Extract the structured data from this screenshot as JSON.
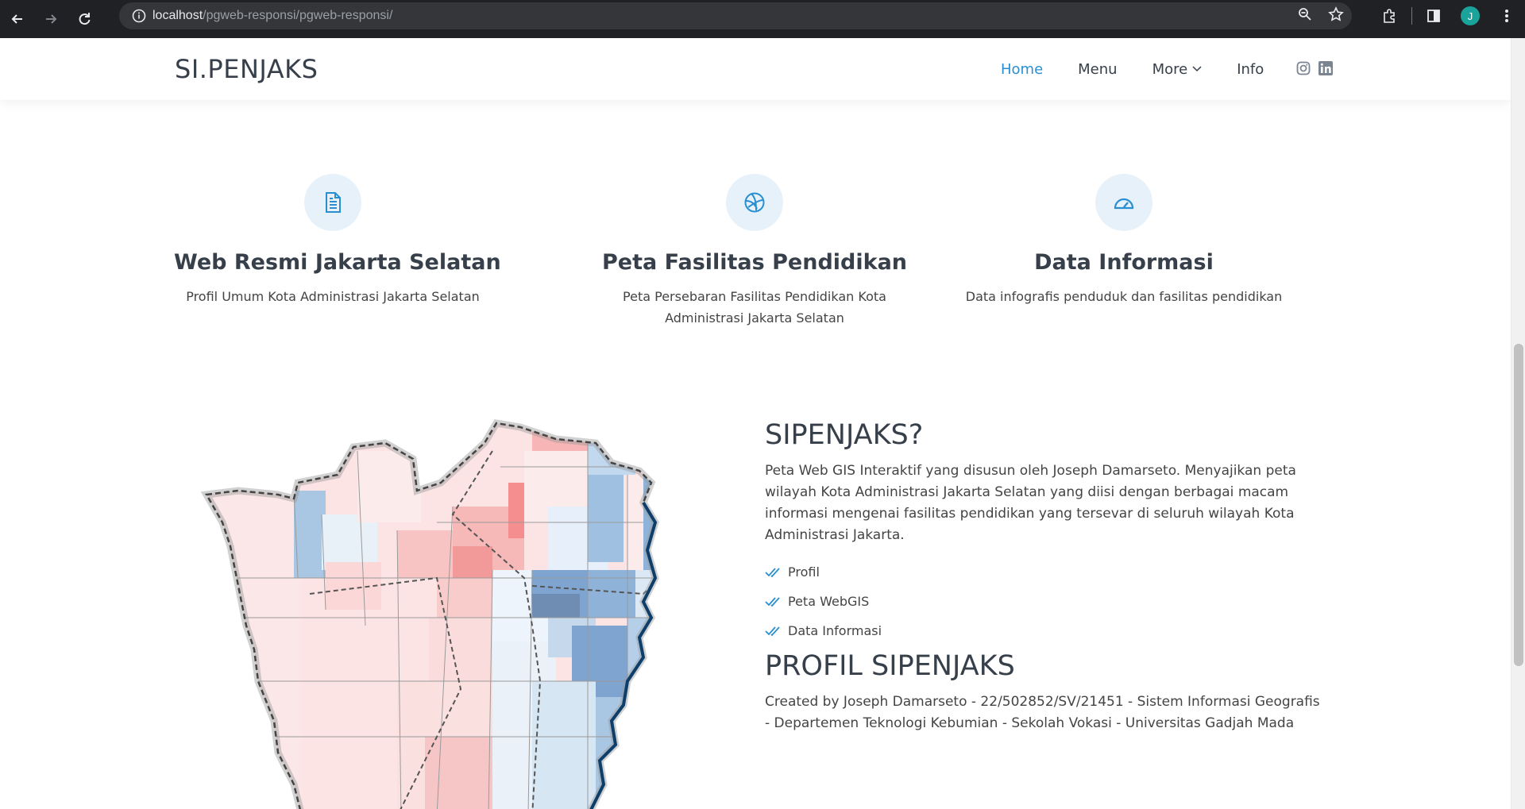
{
  "browser": {
    "url_host": "localhost",
    "url_path": "/pgweb-responsi/pgweb-responsi/",
    "avatar_letter": "J"
  },
  "header": {
    "logo": "SI.PENJAKS",
    "nav": [
      "Home",
      "Menu",
      "More",
      "Info"
    ],
    "active_color": "#2a8fd1"
  },
  "features": [
    {
      "icon": "document-icon",
      "title": "Web Resmi Jakarta Selatan",
      "desc": "Profil Umum Kota Administrasi Jakarta Selatan"
    },
    {
      "icon": "basketball-icon",
      "title": "Peta Fasilitas Pendidikan",
      "desc": "Peta Persebaran Fasilitas Pendidikan Kota Administrasi Jakarta Selatan"
    },
    {
      "icon": "speedometer-icon",
      "title": "Data Informasi",
      "desc": "Data infografis penduduk dan fasilitas pendidikan"
    }
  ],
  "about": {
    "title": "SIPENJAKS?",
    "desc": "Peta Web GIS Interaktif yang disusun oleh Joseph Damarseto. Menyajikan peta wilayah Kota Administrasi Jakarta Selatan yang diisi dengan berbagai macam informasi mengenai fasilitas pendidikan yang tersevar di seluruh wilayah Kota Administrasi Jakarta.",
    "list": [
      "Profil",
      "Peta WebGIS",
      "Data Informasi"
    ],
    "profile_title": "PROFIL SIPENJAKS",
    "profile_desc": "Created by Joseph Damarseto - 22/502852/SV/21451 - Sistem Informasi Geografis - Departemen Teknologi Kebumian - Sekolah Vokasi - Universitas Gadjah Mada"
  }
}
